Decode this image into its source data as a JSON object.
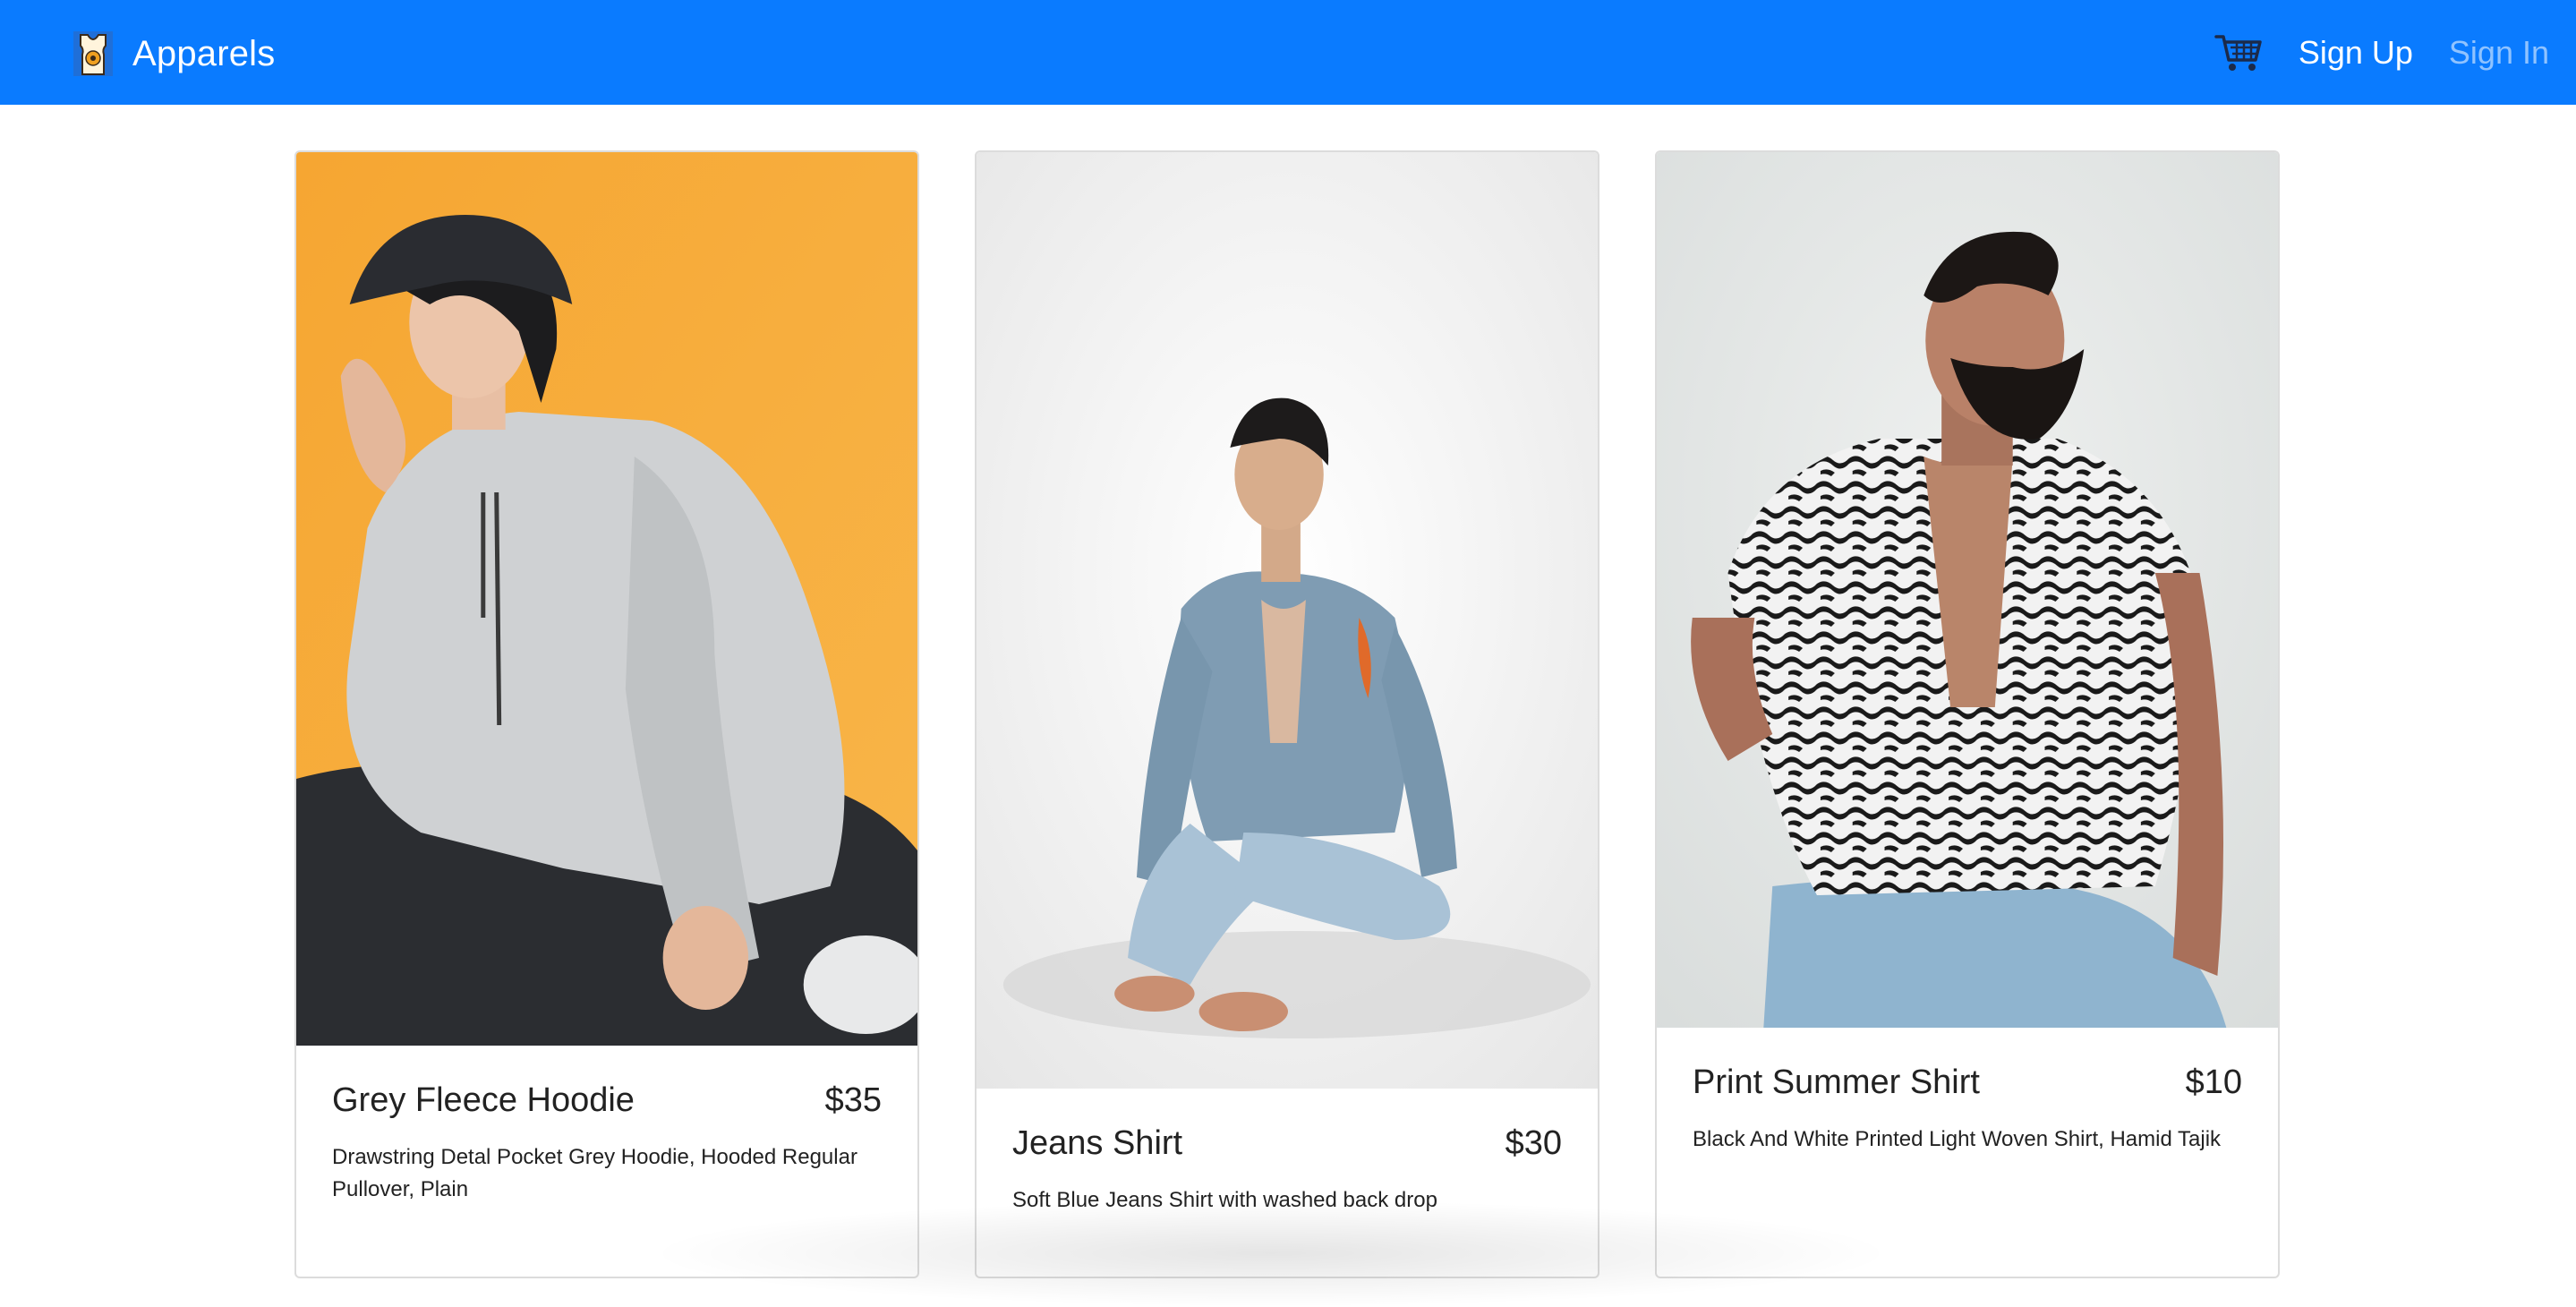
{
  "navbar": {
    "brand": "Apparels",
    "brand_logo_icon": "tank-top-logo-icon",
    "cart_icon": "shopping-cart-icon",
    "signup_label": "Sign Up",
    "signin_label": "Sign In",
    "background_color": "#0a7bff"
  },
  "products": [
    {
      "title": "Grey Fleece Hoodie",
      "price": "$35",
      "description": "Drawstring Detal Pocket Grey Hoodie, Hooded Regular Pullover, Plain",
      "image_subject": "woman in grey hoodie and bucket hat on orange backdrop"
    },
    {
      "title": "Jeans Shirt",
      "price": "$30",
      "description": "Soft Blue Jeans Shirt with washed back drop",
      "image_subject": "man in denim shirt and jeans sitting on white floor"
    },
    {
      "title": "Print Summer Shirt",
      "price": "$10",
      "description": "Black And White Printed Light Woven Shirt, Hamid Tajik",
      "image_subject": "bearded man in black and white print shirt"
    }
  ]
}
